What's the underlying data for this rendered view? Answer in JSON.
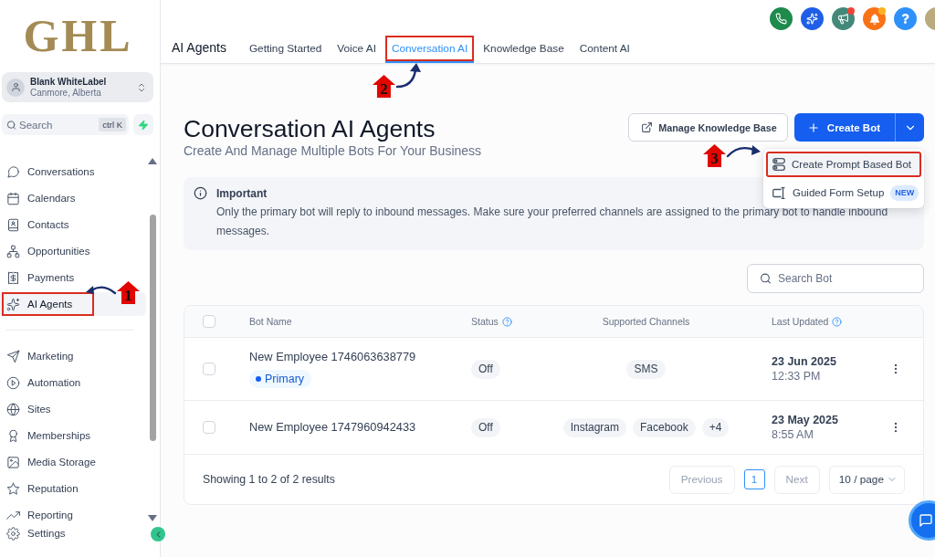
{
  "sidebar": {
    "logo": "GHL",
    "account": {
      "name": "Blank WhiteLabel",
      "location": "Canmore, Alberta"
    },
    "search": {
      "placeholder": "Search",
      "shortcut": "ctrl K"
    },
    "nav_groups": [
      {
        "items": [
          {
            "label": "Conversations",
            "selected": false,
            "outlined": false
          },
          {
            "label": "Calendars",
            "selected": false,
            "outlined": false
          },
          {
            "label": "Contacts",
            "selected": false,
            "outlined": false
          },
          {
            "label": "Opportunities",
            "selected": false,
            "outlined": false
          },
          {
            "label": "Payments",
            "selected": false,
            "outlined": false
          },
          {
            "label": "AI Agents",
            "selected": true,
            "outlined": true,
            "step": "1"
          }
        ]
      },
      {
        "items": [
          {
            "label": "Marketing",
            "selected": false,
            "outlined": false
          },
          {
            "label": "Automation",
            "selected": false,
            "outlined": false
          },
          {
            "label": "Sites",
            "selected": false,
            "outlined": false
          },
          {
            "label": "Memberships",
            "selected": false,
            "outlined": false
          },
          {
            "label": "Media Storage",
            "selected": false,
            "outlined": false
          },
          {
            "label": "Reputation",
            "selected": false,
            "outlined": false
          },
          {
            "label": "Reporting",
            "selected": false,
            "outlined": false
          }
        ]
      }
    ],
    "footer_item": {
      "label": "Settings",
      "selected": false
    }
  },
  "header": {
    "quick_actions": [
      {
        "kind": "phone",
        "color": "#1e8a4c"
      },
      {
        "kind": "sparkle",
        "color": "#1f5ee6"
      },
      {
        "kind": "megaphone",
        "color": "#43897a",
        "badge": {
          "color": "#f04438"
        }
      },
      {
        "kind": "bell",
        "color": "#f97316",
        "badge": {
          "color": "#fdb022"
        }
      },
      {
        "kind": "help",
        "color": "#2e90fa"
      },
      {
        "kind": "avatar",
        "color": "#b9ab7d"
      }
    ],
    "title": "AI Agents",
    "tabs": [
      {
        "label": "Getting Started",
        "selected": false,
        "outlined": false
      },
      {
        "label": "Voice AI",
        "selected": false,
        "outlined": false
      },
      {
        "label": "Conversation AI",
        "selected": true,
        "outlined": true,
        "step": "2"
      },
      {
        "label": "Knowledge Base",
        "selected": false,
        "outlined": false
      },
      {
        "label": "Content AI",
        "selected": false,
        "outlined": false
      }
    ]
  },
  "page": {
    "title": "Conversation AI Agents",
    "subtitle": "Create And Manage Multiple Bots For Your Business",
    "secondary_action": "Manage Knowledge Base",
    "primary_action": "Create Bot",
    "create_menu": {
      "open": true,
      "items": [
        {
          "label": "Create Prompt Based Bot",
          "hovered": true,
          "outlined": true,
          "step": "3"
        },
        {
          "label": "Guided Form Setup",
          "hovered": false,
          "outlined": false,
          "badge": "NEW"
        }
      ]
    }
  },
  "notice": {
    "title": "Important",
    "body": "Only the primary bot will reply to inbound messages. Make sure your preferred channels are assigned to the primary bot to handle inbound messages."
  },
  "search": {
    "placeholder": "Search Bot"
  },
  "table": {
    "select_all": {
      "checked": false
    },
    "columns": [
      {
        "label": "Bot Name",
        "help": false
      },
      {
        "label": "Status",
        "help": true
      },
      {
        "label": "Supported Channels",
        "help": false
      },
      {
        "label": "Last Updated",
        "help": true
      }
    ],
    "rows": [
      {
        "checked": false,
        "name": "New Employee 1746063638779",
        "badge": "Primary",
        "status": "Off",
        "channels": [
          "SMS"
        ],
        "date": "23 Jun 2025",
        "time": "12:33 PM"
      },
      {
        "checked": false,
        "name": "New Employee 1747960942433",
        "status": "Off",
        "channels": [
          "Instagram",
          "Facebook",
          "+4"
        ],
        "date": "23 May 2025",
        "time": "8:55 AM"
      }
    ],
    "summary": "Showing 1 to 2 of 2 results",
    "pagination": {
      "previous": {
        "label": "Previous",
        "disabled": true
      },
      "pages": [
        {
          "label": "1",
          "selected": true
        }
      ],
      "next": {
        "label": "Next",
        "disabled": true
      },
      "page_size": "10 / page"
    }
  }
}
